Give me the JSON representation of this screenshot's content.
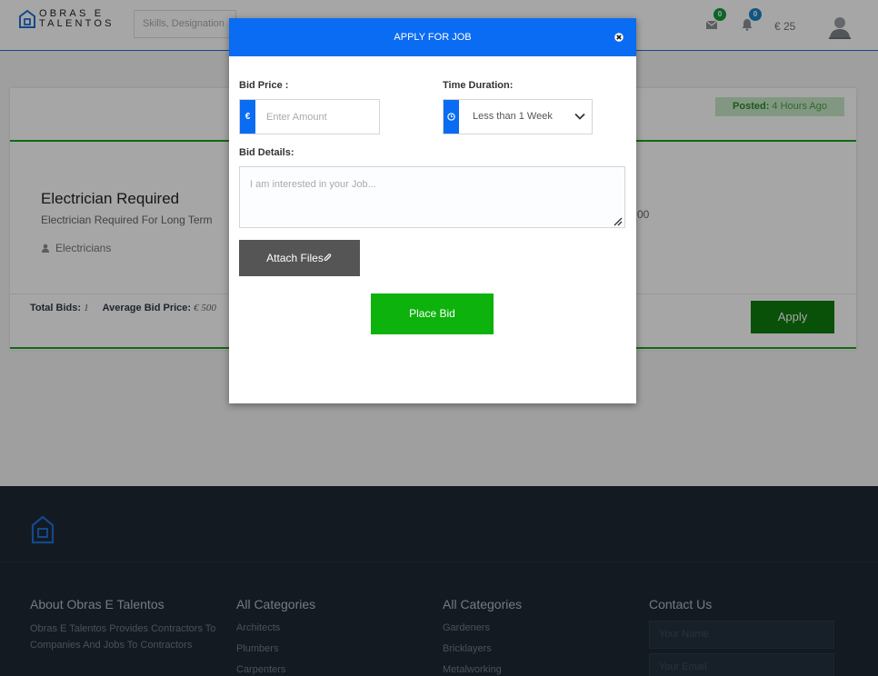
{
  "header": {
    "logo_line1": "OBRAS E",
    "logo_line2": "TALENTOS",
    "search_placeholder": "Skills, Designation",
    "messages_count": "0",
    "notifications_count": "0",
    "wallet": "€ 25",
    "colors": {
      "accent": "#1f6fd8",
      "messages_badge": "#139a3c",
      "notifications_badge": "#1a84c8"
    }
  },
  "job": {
    "posted_label": "Posted:",
    "posted_value": "4 Hours Ago",
    "title": "Electrician Required",
    "subtitle": "Electrician Required For Long Term",
    "category": "Electricians",
    "side_fragment": "00",
    "total_bids_label": "Total Bids:",
    "total_bids_value": "1",
    "avg_bid_label": "Average Bid Price:",
    "avg_bid_value": "€ 500",
    "apply_label": "Apply"
  },
  "modal": {
    "title": "APPLY FOR JOB",
    "close_icon": "close-icon",
    "bid_price_label": "Bid Price :",
    "bid_price_addon": "€",
    "bid_price_placeholder": "Enter Amount",
    "duration_label": "Time Duration:",
    "duration_selected": "Less than 1 Week",
    "details_label": "Bid Details:",
    "details_placeholder": "I am interested in your Job...",
    "attach_label": "Attach Files",
    "place_bid_label": "Place Bid",
    "colors": {
      "header": "#0a6cf2",
      "place_bid": "#0db20d",
      "attach": "#555555"
    }
  },
  "footer": {
    "about_title": "About Obras E Talentos",
    "about_text": "Obras E Talentos Provides Contractors To Companies And Jobs To Contractors",
    "categories1_title": "All Categories",
    "categories1": [
      "Architects",
      "Plumbers",
      "Carpenters"
    ],
    "categories2_title": "All Categories",
    "categories2": [
      "Gardeners",
      "Bricklayers",
      "Metalworking"
    ],
    "contact_title": "Contact Us",
    "contact_name_placeholder": "Your Name",
    "contact_email_placeholder": "Your Email"
  }
}
